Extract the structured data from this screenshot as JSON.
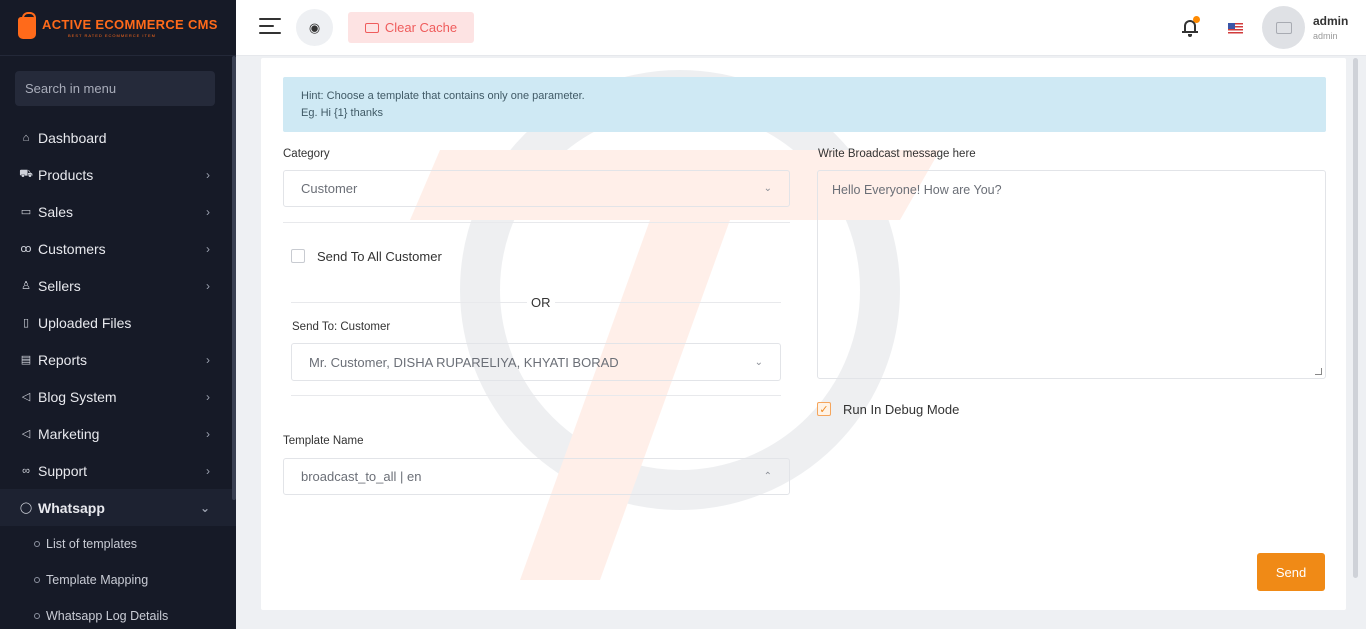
{
  "brand": {
    "title": "ACTIVE ECOMMERCE CMS",
    "subtitle": "BEST RATED ECOMMERCE ITEM"
  },
  "sidebar": {
    "search_placeholder": "Search in menu",
    "items": [
      {
        "label": "Dashboard",
        "icon": "home-icon",
        "glyph": "⌂"
      },
      {
        "label": "Products",
        "icon": "cart-icon",
        "glyph": "⛟"
      },
      {
        "label": "Sales",
        "icon": "money-icon",
        "glyph": "▭"
      },
      {
        "label": "Customers",
        "icon": "users-icon",
        "glyph": "ꝏ"
      },
      {
        "label": "Sellers",
        "icon": "user-icon",
        "glyph": "♙"
      },
      {
        "label": "Uploaded Files",
        "icon": "file-icon",
        "glyph": "▯"
      },
      {
        "label": "Reports",
        "icon": "report-icon",
        "glyph": "▤"
      },
      {
        "label": "Blog System",
        "icon": "megaphone-icon",
        "glyph": "◁"
      },
      {
        "label": "Marketing",
        "icon": "megaphone-icon",
        "glyph": "◁"
      },
      {
        "label": "Support",
        "icon": "link-icon",
        "glyph": "∞"
      },
      {
        "label": "Whatsapp",
        "icon": "whatsapp-icon",
        "glyph": "◯"
      }
    ],
    "whatsapp_sub": [
      {
        "label": "List of templates"
      },
      {
        "label": "Template Mapping"
      },
      {
        "label": "Whatsapp Log Details"
      }
    ]
  },
  "topbar": {
    "clear_cache": "Clear Cache",
    "user_name": "admin",
    "user_role": "admin"
  },
  "form": {
    "hint_line1": "Hint: Choose a template that contains only one parameter.",
    "hint_line2": "Eg. Hi {1} thanks",
    "category_label": "Category",
    "category_value": "Customer",
    "send_all_label": "Send To All Customer",
    "send_all_checked": false,
    "or_text": "OR",
    "send_to_label": "Send To: Customer",
    "send_to_value": "Mr. Customer, DISHA RUPARELIYA, KHYATI BORAD",
    "template_label": "Template Name",
    "template_value": "broadcast_to_all | en",
    "message_label": "Write Broadcast message here",
    "message_value": "Hello Everyone! How are You?",
    "debug_label": "Run In Debug Mode",
    "debug_checked": true,
    "send_button": "Send"
  },
  "colors": {
    "accent": "#f08a16",
    "sidebar": "#161a27",
    "hint_bg": "#cfe9f4",
    "cache_bg": "#fde3e3"
  }
}
